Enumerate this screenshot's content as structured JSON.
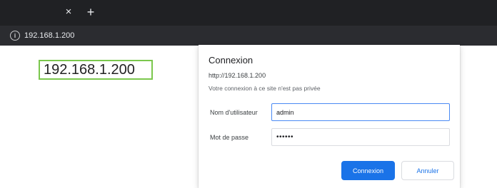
{
  "browser": {
    "close_glyph": "×",
    "new_tab_glyph": "+",
    "info_glyph": "i",
    "address_url": "192.168.1.200"
  },
  "page": {
    "url_display": "192.168.1.200"
  },
  "dialog": {
    "title": "Connexion",
    "url": "http://192.168.1.200",
    "warning": "Votre connexion à ce site n'est pas privée",
    "username_label": "Nom d'utilisateur",
    "username_value": "admin",
    "password_label": "Mot de passe",
    "password_value": "••••••",
    "login_button": "Connexion",
    "cancel_button": "Annuler"
  },
  "colors": {
    "tabbar_bg": "#202124",
    "addressbar_bg": "#2b2c30",
    "accent_blue": "#1a73e8",
    "highlight_green": "#7bc74d"
  }
}
